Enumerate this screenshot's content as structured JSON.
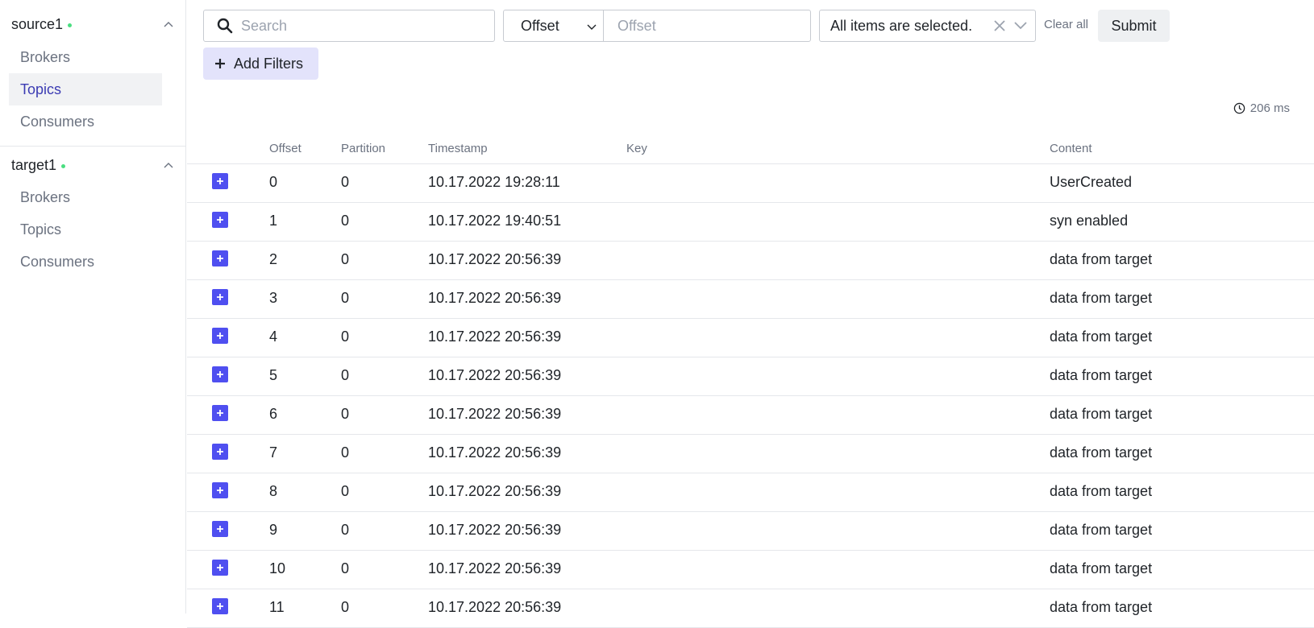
{
  "sidebar": {
    "clusters": [
      {
        "name": "source1",
        "items": [
          {
            "label": "Brokers",
            "active": false
          },
          {
            "label": "Topics",
            "active": true
          },
          {
            "label": "Consumers",
            "active": false
          }
        ]
      },
      {
        "name": "target1",
        "items": [
          {
            "label": "Brokers",
            "active": false
          },
          {
            "label": "Topics",
            "active": false
          },
          {
            "label": "Consumers",
            "active": false
          }
        ]
      }
    ],
    "status_color": "#4ade80",
    "active_color": "#3b3bb3"
  },
  "toolbar": {
    "search_placeholder": "Search",
    "seek_type": "Offset",
    "offset_placeholder": "Offset",
    "partitions_value": "All items are selected.",
    "clear_all": "Clear all",
    "submit": "Submit",
    "add_filters": "Add Filters"
  },
  "elapsed": "206 ms",
  "table": {
    "headers": {
      "offset": "Offset",
      "partition": "Partition",
      "timestamp": "Timestamp",
      "key": "Key",
      "content": "Content"
    },
    "rows": [
      {
        "offset": "0",
        "partition": "0",
        "timestamp": "10.17.2022 19:28:11",
        "key": "",
        "content": "UserCreated"
      },
      {
        "offset": "1",
        "partition": "0",
        "timestamp": "10.17.2022 19:40:51",
        "key": "",
        "content": "syn enabled"
      },
      {
        "offset": "2",
        "partition": "0",
        "timestamp": "10.17.2022 20:56:39",
        "key": "",
        "content": "data from target"
      },
      {
        "offset": "3",
        "partition": "0",
        "timestamp": "10.17.2022 20:56:39",
        "key": "",
        "content": "data from target"
      },
      {
        "offset": "4",
        "partition": "0",
        "timestamp": "10.17.2022 20:56:39",
        "key": "",
        "content": "data from target"
      },
      {
        "offset": "5",
        "partition": "0",
        "timestamp": "10.17.2022 20:56:39",
        "key": "",
        "content": "data from target"
      },
      {
        "offset": "6",
        "partition": "0",
        "timestamp": "10.17.2022 20:56:39",
        "key": "",
        "content": "data from target"
      },
      {
        "offset": "7",
        "partition": "0",
        "timestamp": "10.17.2022 20:56:39",
        "key": "",
        "content": "data from target"
      },
      {
        "offset": "8",
        "partition": "0",
        "timestamp": "10.17.2022 20:56:39",
        "key": "",
        "content": "data from target"
      },
      {
        "offset": "9",
        "partition": "0",
        "timestamp": "10.17.2022 20:56:39",
        "key": "",
        "content": "data from target"
      },
      {
        "offset": "10",
        "partition": "0",
        "timestamp": "10.17.2022 20:56:39",
        "key": "",
        "content": "data from target"
      },
      {
        "offset": "11",
        "partition": "0",
        "timestamp": "10.17.2022 20:56:39",
        "key": "",
        "content": "data from target"
      }
    ]
  },
  "colors": {
    "accent": "#4f4ff0",
    "add_filters_bg": "#e3e3fb",
    "border": "#e5e7eb"
  },
  "icons": {
    "search": "search-icon",
    "chevron": "chevron-down-icon",
    "clear": "close-icon",
    "clock": "clock-icon",
    "plus": "plus-icon",
    "expand": "expand-plus-icon",
    "collapse": "chevron-up-icon"
  }
}
